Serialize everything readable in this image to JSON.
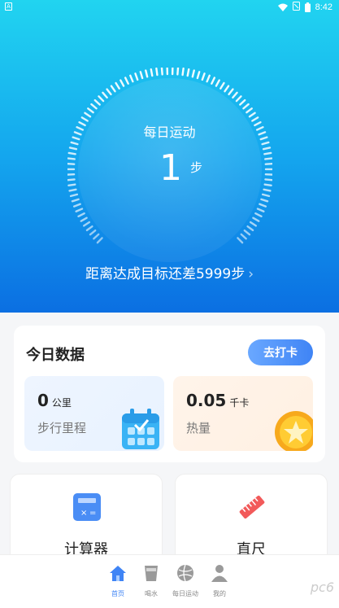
{
  "status_bar": {
    "time": "8:42",
    "app_indicator": "A"
  },
  "hero": {
    "title": "每日运动",
    "steps": "1",
    "steps_unit": "步",
    "goal_text": "距离达成目标还差5999步",
    "goal_chevron": "›"
  },
  "today": {
    "title": "今日数据",
    "checkin_label": "去打卡",
    "distance": {
      "value": "0",
      "unit": "公里",
      "label": "步行里程"
    },
    "calories": {
      "value": "0.05",
      "unit": "千卡",
      "label": "热量"
    }
  },
  "tools": [
    {
      "name": "计算器",
      "icon": "calculator-icon"
    },
    {
      "name": "直尺",
      "icon": "ruler-icon"
    }
  ],
  "tabs": [
    {
      "label": "首页",
      "icon": "home-icon",
      "active": true
    },
    {
      "label": "喝水",
      "icon": "cup-icon",
      "active": false
    },
    {
      "label": "每日运动",
      "icon": "ball-icon",
      "active": false
    },
    {
      "label": "我的",
      "icon": "user-icon",
      "active": false
    }
  ],
  "watermark": "pc6",
  "colors": {
    "accent": "#3f84f5",
    "hero_top": "#21d4f0",
    "hero_bottom": "#0b6fe2"
  }
}
